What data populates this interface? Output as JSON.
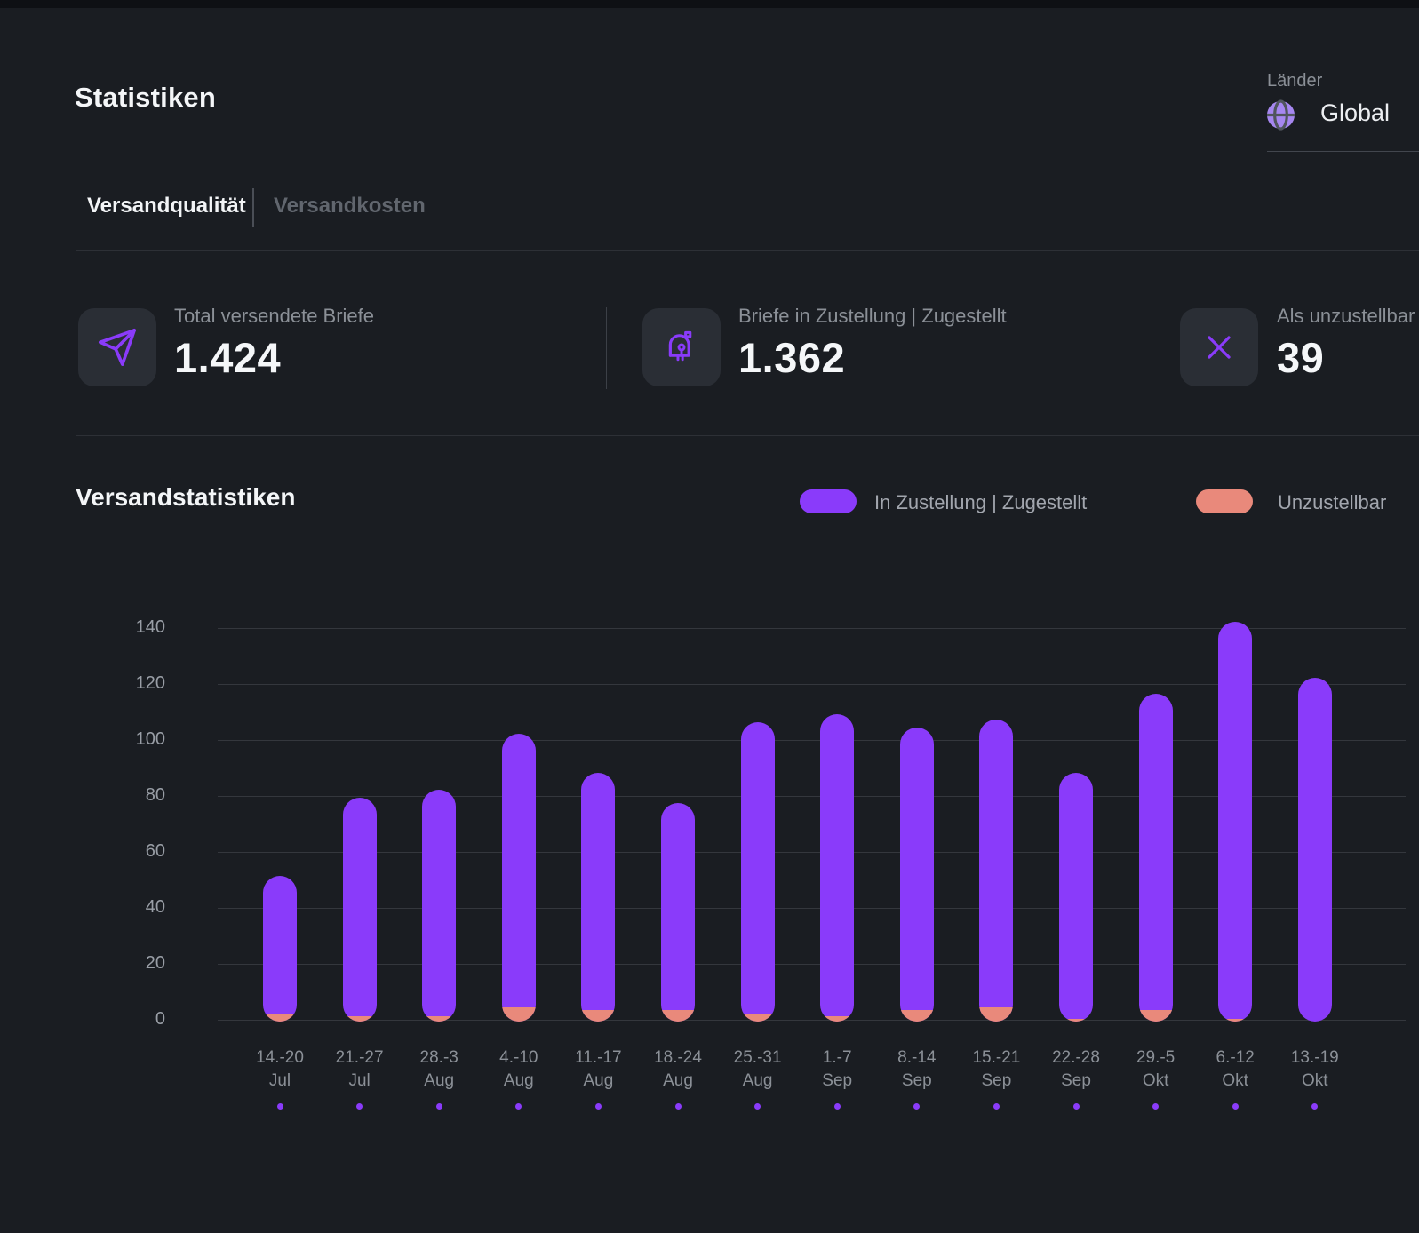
{
  "header": {
    "title": "Statistiken",
    "country_label": "Länder",
    "country_value": "Global"
  },
  "tabs": [
    {
      "label": "Versandqualität",
      "active": true
    },
    {
      "label": "Versandkosten",
      "active": false
    }
  ],
  "stats": [
    {
      "icon": "send-icon",
      "label": "Total versendete Briefe",
      "value": "1.424"
    },
    {
      "icon": "mailbox-icon",
      "label": "Briefe in Zustellung | Zugestellt",
      "value": "1.362"
    },
    {
      "icon": "x-icon",
      "label": "Als unzustellbar",
      "value": "39"
    }
  ],
  "section": {
    "title": "Versandstatistiken"
  },
  "legend": [
    {
      "label": "In Zustellung | Zugestellt",
      "color": "#8A3BFA"
    },
    {
      "label": "Unzustellbar",
      "color": "#E9897B"
    }
  ],
  "colors": {
    "accent_purple": "#8A3BFA",
    "accent_salmon": "#E9897B",
    "background": "#1A1D22"
  },
  "chart_data": {
    "type": "bar",
    "stacked": true,
    "categories": [
      "14.-20 Jul",
      "21.-27 Jul",
      "28.-3 Aug",
      "4.-10 Aug",
      "11.-17 Aug",
      "18.-24 Aug",
      "25.-31 Aug",
      "1.-7 Sep",
      "8.-14 Sep",
      "15.-21 Sep",
      "22.-28 Sep",
      "29.-5 Okt",
      "6.-12 Okt",
      "13.-19 Okt"
    ],
    "series": [
      {
        "name": "In Zustellung | Zugestellt",
        "color": "#8A3BFA",
        "values": [
          49,
          78,
          81,
          98,
          85,
          74,
          104,
          108,
          101,
          103,
          88,
          113,
          142,
          123
        ]
      },
      {
        "name": "Unzustellbar",
        "color": "#E9897B",
        "values": [
          3,
          2,
          2,
          5,
          4,
          4,
          3,
          2,
          4,
          5,
          1,
          4,
          1,
          0
        ]
      }
    ],
    "title": "Versandstatistiken",
    "xlabel": "",
    "ylabel": "",
    "ylim": [
      0,
      140
    ],
    "yticks": [
      0,
      20,
      40,
      60,
      80,
      100,
      120,
      140
    ],
    "grid": "horizontal",
    "legend_position": "top-right"
  }
}
